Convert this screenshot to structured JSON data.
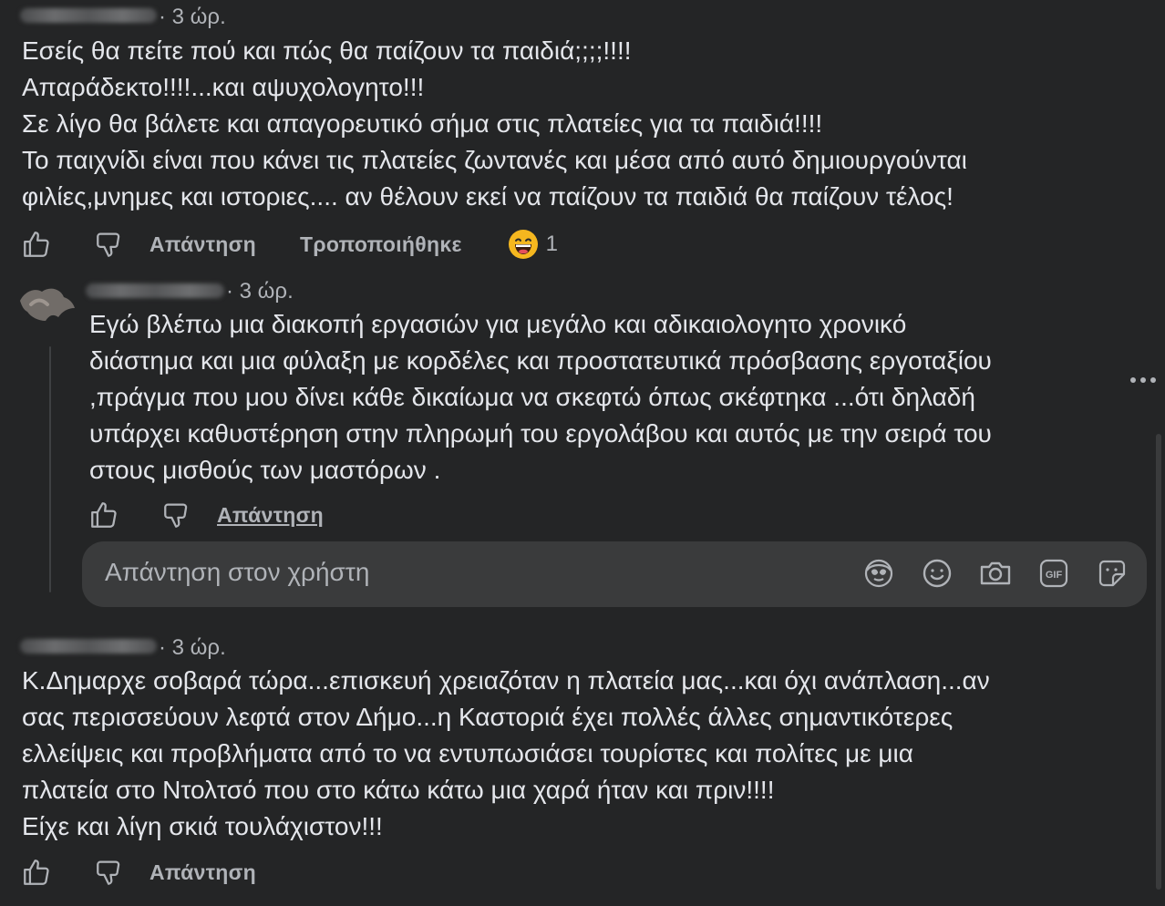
{
  "comments": [
    {
      "time": "· 3 ώρ.",
      "text": "Εσείς θα πείτε πού και πώς θα παίζουν τα παιδιά;;;;!!!!\nΑπαράδεκτο!!!!...και αψυχολογητο!!!\nΣε λίγο θα βάλετε και απαγορευτικό σήμα στις πλατείες για τα παιδιά!!!!\nΤο παιχνίδι είναι που κάνει τις πλατείες ζωντανές και μέσα από αυτό δημιουργούνται\nφιλίες,μνημες και ιστοριες.... αν θέλουν εκεί να παίζουν τα παιδιά θα παίζουν τέλος!",
      "reply_label": "Απάντηση",
      "edited_label": "Τροποποιήθηκε",
      "reaction_icon": "grinning-face-emoji",
      "reaction_count": "1"
    },
    {
      "time": "· 3 ώρ.",
      "text": "Εγώ βλέπω μια διακοπή εργασιών για μεγάλο και αδικαιολογητο χρονικό\nδιάστημα και μια φύλαξη με κορδέλες και προστατευτικά πρόσβασης εργοταξίου\n,πράγμα που μου δίνει κάθε δικαίωμα να σκεφτώ όπως σκέφτηκα ...ότι δηλαδή\nυπάρχει καθυστέρηση στην πληρωμή του εργολάβου και αυτός με την σειρά του\nστους μισθούς των μαστόρων .",
      "reply_label": "Απάντηση"
    },
    {
      "time": "· 3 ώρ.",
      "text": "Κ.Δημαρχε σοβαρά τώρα...επισκευή χρειαζόταν η πλατεία μας...και όχι ανάπλαση...αν\nσας περισσεύουν λεφτά στον Δήμο...η Καστοριά έχει πολλές άλλες σημαντικότερες\nελλείψεις και προβλήματα από το να εντυπωσιάσει τουρίστες και πολίτες με μια\nπλατεία στο Ντολτσό που στο κάτω κάτω μια χαρά ήταν και πριν!!!!\nΕίχε και λίγη σκιά τουλάχιστον!!!",
      "reply_label": "Απάντηση"
    }
  ],
  "reply_box": {
    "placeholder": "Απάντηση στον χρήστη",
    "icons": [
      "avatar-sticker-icon",
      "emoji-icon",
      "camera-icon",
      "gif-icon",
      "sticker-icon"
    ]
  },
  "colors": {
    "background": "#242526",
    "text": "#e4e6eb",
    "secondary": "#b0b3b8",
    "input": "#3a3b3c"
  }
}
